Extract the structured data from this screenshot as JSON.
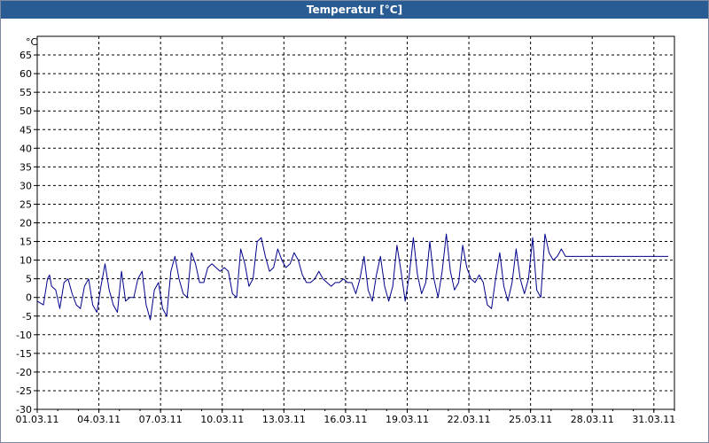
{
  "window": {
    "title": "Temperatur [°C]"
  },
  "colors": {
    "titlebar": "#2a5c94",
    "series": "#00008b",
    "grid": "#000000",
    "axis": "#000000"
  },
  "chart_data": {
    "type": "line",
    "title": "Temperatur [°C]",
    "ylabel": "°C",
    "xlabel": "",
    "ylim": [
      -30,
      70
    ],
    "xlim": [
      "01.03.11",
      "01.04.11"
    ],
    "grid": true,
    "y_ticks": [
      -30,
      -25,
      -20,
      -15,
      -10,
      -5,
      0,
      5,
      10,
      15,
      20,
      25,
      30,
      35,
      40,
      45,
      50,
      55,
      60,
      65
    ],
    "x_ticks": [
      "01.03.11",
      "04.03.11",
      "07.03.11",
      "10.03.11",
      "13.03.11",
      "16.03.11",
      "19.03.11",
      "22.03.11",
      "25.03.11",
      "28.03.11",
      "31.03.11"
    ],
    "series": [
      {
        "x_days": [
          0,
          0.3,
          0.5,
          0.6,
          0.7,
          0.9,
          1.1,
          1.3,
          1.5,
          1.7,
          1.9,
          2.1,
          2.3,
          2.5,
          2.7,
          2.9,
          3.1,
          3.3,
          3.5,
          3.7,
          3.9,
          4.1,
          4.3,
          4.5,
          4.7,
          4.9,
          5.1,
          5.3,
          5.5,
          5.7,
          5.9,
          6.1,
          6.3,
          6.5,
          6.7,
          6.9,
          7.1,
          7.3,
          7.5,
          7.7,
          7.9,
          8.1,
          8.3,
          8.5,
          8.7,
          8.9,
          9.1,
          9.3,
          9.5,
          9.7,
          9.9,
          10.1,
          10.3,
          10.5,
          10.7,
          10.9,
          11.1,
          11.3,
          11.5,
          11.7,
          11.9,
          12.1,
          12.3,
          12.5,
          12.7,
          12.9,
          13.1,
          13.3,
          13.5,
          13.7,
          13.9,
          14.1,
          14.3,
          14.5,
          14.7,
          14.9,
          15.1,
          15.3,
          15.5,
          15.7,
          15.9,
          16.1,
          16.3,
          16.5,
          16.7,
          16.9,
          17.1,
          17.3,
          17.5,
          17.7,
          17.9,
          18.1,
          18.3,
          18.5,
          18.7,
          18.9,
          19.1,
          19.3,
          19.5,
          19.7,
          19.9,
          20.1,
          20.3,
          20.5,
          20.7,
          20.9,
          21.1,
          21.3,
          21.5,
          21.7,
          21.9,
          22.1,
          22.3,
          22.5,
          22.7,
          22.9,
          23.1,
          23.3,
          23.5,
          23.7,
          23.9,
          24.1,
          24.3,
          24.5,
          24.7,
          24.9,
          25.1,
          25.3,
          25.5,
          25.7,
          25.9,
          26.1,
          26.3,
          26.5,
          26.7,
          26.9,
          27.1,
          27.3,
          27.5,
          27.7,
          27.9,
          28.1,
          28.3,
          28.5,
          28.7,
          28.9,
          29.1,
          29.3,
          29.5,
          29.7,
          29.9,
          30.1,
          30.3,
          30.5,
          30.7,
          30.9,
          31.0
        ],
        "values": [
          -1,
          -2,
          5,
          6,
          3,
          2,
          -3,
          4,
          5,
          1,
          -2,
          -3,
          3,
          5,
          -2,
          -4,
          3,
          9,
          2,
          -2,
          -4,
          7,
          -1,
          0,
          0,
          5,
          7,
          -2,
          -6,
          2,
          4,
          -3,
          -5,
          7,
          11,
          5,
          1,
          0,
          12,
          9,
          4,
          4,
          8,
          9,
          8,
          7,
          8,
          7,
          1,
          0,
          13,
          9,
          3,
          5,
          15,
          16,
          11,
          7,
          8,
          13,
          10,
          8,
          9,
          12,
          10,
          6,
          4,
          4,
          5,
          7,
          5,
          4,
          3,
          4,
          4,
          5,
          4,
          4,
          1,
          5,
          11,
          2,
          -1,
          6,
          11,
          3,
          -1,
          3,
          14,
          7,
          -1,
          6,
          16,
          6,
          1,
          4,
          15,
          5,
          0,
          7,
          17,
          7,
          2,
          4,
          14,
          8,
          5,
          4,
          6,
          4,
          -2,
          -3,
          5,
          12,
          3,
          -1,
          4,
          13,
          5,
          1,
          5,
          16,
          2,
          0,
          17,
          12,
          10,
          11,
          13,
          11,
          11,
          11,
          11,
          11,
          11,
          11,
          11,
          11,
          11,
          11,
          11,
          11,
          11,
          11,
          11,
          11,
          11,
          11,
          11,
          11,
          11,
          11,
          11,
          11,
          11
        ]
      }
    ]
  }
}
